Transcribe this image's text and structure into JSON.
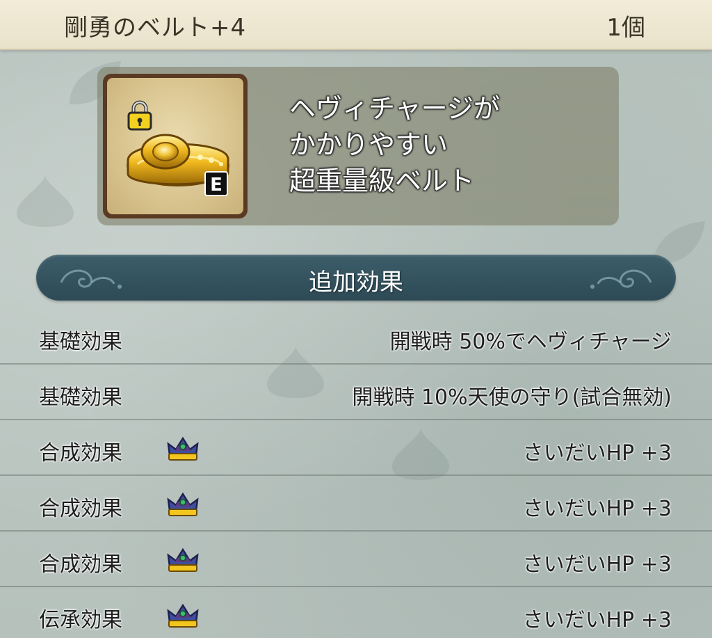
{
  "header": {
    "item_name": "剛勇のベルト+4",
    "count": "1個"
  },
  "item": {
    "icon": "gold-belt-icon",
    "locked_icon": "padlock-icon",
    "equip_badge": "E",
    "description_lines": [
      "ヘヴィチャージが",
      "かかりやすい",
      "超重量級ベルト"
    ]
  },
  "section": {
    "title": "追加効果"
  },
  "effects": [
    {
      "label": "基礎効果",
      "icon": null,
      "value": "開戦時  50%でヘヴィチャージ"
    },
    {
      "label": "基礎効果",
      "icon": null,
      "value": "開戦時  10%天使の守り(試合無効)"
    },
    {
      "label": "合成効果",
      "icon": "crown-icon",
      "value": "さいだいHP  +3"
    },
    {
      "label": "合成効果",
      "icon": "crown-icon",
      "value": "さいだいHP  +3"
    },
    {
      "label": "合成効果",
      "icon": "crown-icon",
      "value": "さいだいHP  +3"
    },
    {
      "label": "伝承効果",
      "icon": "crown-icon",
      "value": "さいだいHP  +3"
    }
  ],
  "colors": {
    "header_bg": "#f2ecd8",
    "banner_bg": "#3d5d6a",
    "panel_bg": "#7a785f",
    "body_bg": "#b9c4bf"
  }
}
